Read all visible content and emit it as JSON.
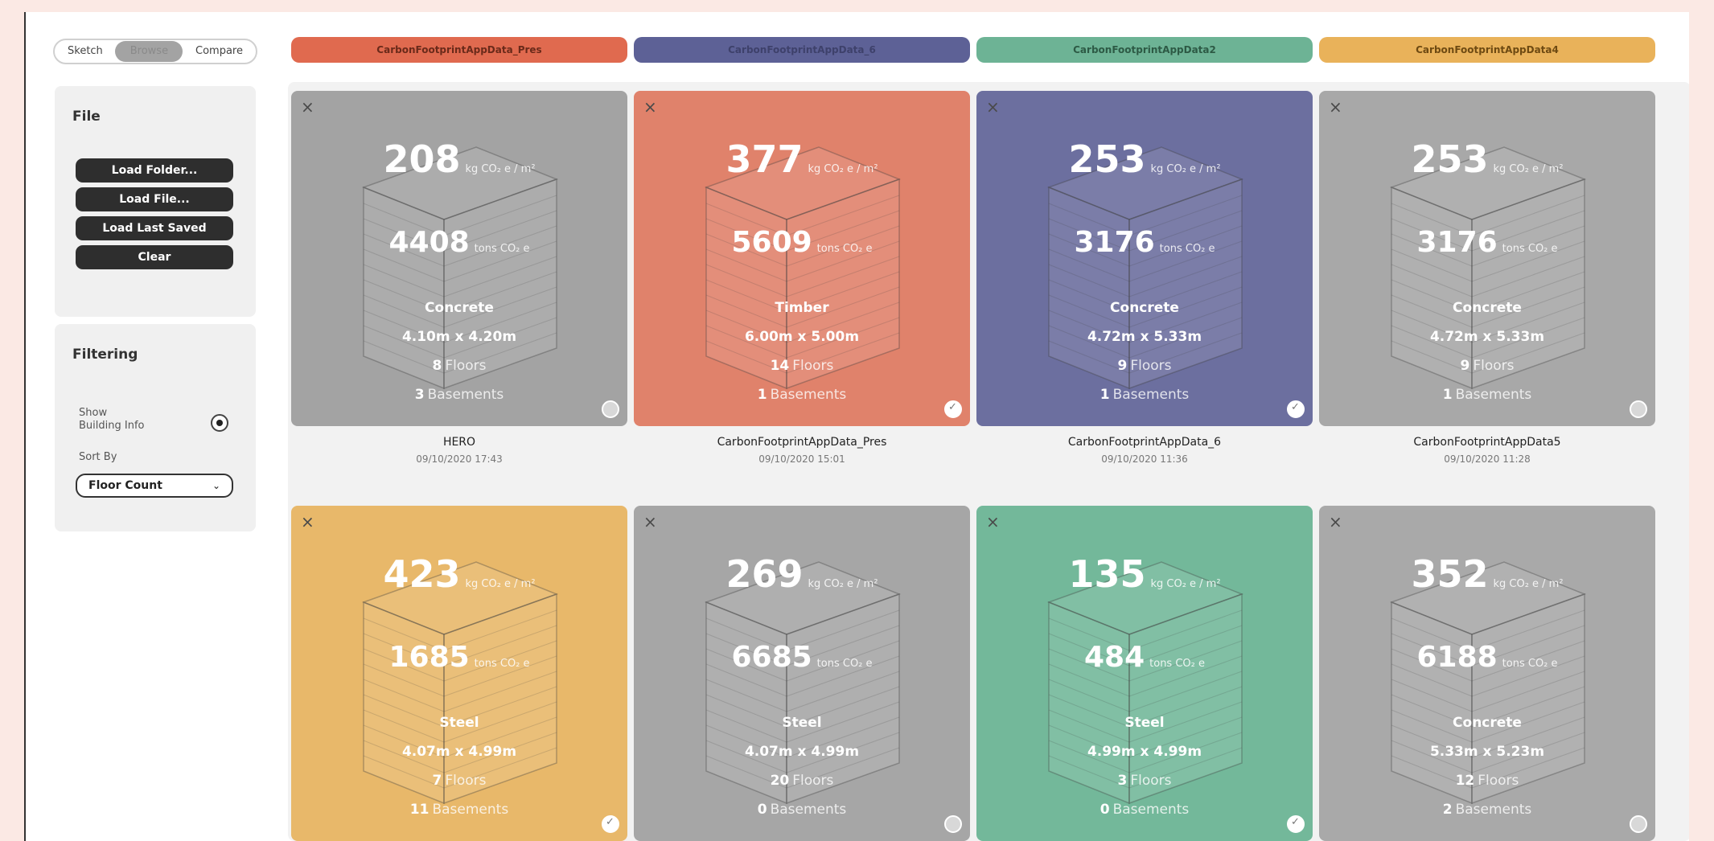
{
  "mode_toggle": {
    "options": [
      "Sketch",
      "Browse",
      "Compare"
    ],
    "active": "Browse"
  },
  "sidebar": {
    "file": {
      "title": "File",
      "buttons": [
        "Load Folder...",
        "Load File...",
        "Load Last Saved",
        "Clear"
      ]
    },
    "filtering": {
      "title": "Filtering",
      "show_building_info_label": "Show\nBuilding Info",
      "show_building_info": true,
      "sort_label": "Sort By",
      "sort_value": "Floor Count",
      "sort_chevron": "⌄"
    }
  },
  "header_pills": [
    {
      "label": "CarbonFootprintAppData_Pres",
      "color": "#e06a4f"
    },
    {
      "label": "CarbonFootprintAppData_6",
      "color": "#5d6196"
    },
    {
      "label": "CarbonFootprintAppData2",
      "color": "#6db395"
    },
    {
      "label": "CarbonFootprintAppData4",
      "color": "#e9b25a"
    }
  ],
  "cards": [
    {
      "color": "#a3a3a3",
      "intensity": "208",
      "intensity_unit": "kg CO₂ e / m²",
      "total": "4408",
      "total_unit": "tons CO₂ e",
      "material": "Concrete",
      "dimensions": "4.10m x 4.20m",
      "floors": "8",
      "floors_label": "Floors",
      "basements": "3",
      "basements_label": "Basements",
      "name": "HERO",
      "date": "09/10/2020 17:43",
      "checked": false
    },
    {
      "color": "#e0826b",
      "intensity": "377",
      "intensity_unit": "kg CO₂ e / m²",
      "total": "5609",
      "total_unit": "tons CO₂ e",
      "material": "Timber",
      "dimensions": "6.00m x 5.00m",
      "floors": "14",
      "floors_label": "Floors",
      "basements": "1",
      "basements_label": "Basements",
      "name": "CarbonFootprintAppData_Pres",
      "date": "09/10/2020 15:01",
      "checked": true
    },
    {
      "color": "#6c6f9f",
      "intensity": "253",
      "intensity_unit": "kg CO₂ e / m²",
      "total": "3176",
      "total_unit": "tons CO₂ e",
      "material": "Concrete",
      "dimensions": "4.72m x 5.33m",
      "floors": "9",
      "floors_label": "Floors",
      "basements": "1",
      "basements_label": "Basements",
      "name": "CarbonFootprintAppData_6",
      "date": "09/10/2020 11:36",
      "checked": true
    },
    {
      "color": "#a8a8a8",
      "intensity": "253",
      "intensity_unit": "kg CO₂ e / m²",
      "total": "3176",
      "total_unit": "tons CO₂ e",
      "material": "Concrete",
      "dimensions": "4.72m x 5.33m",
      "floors": "9",
      "floors_label": "Floors",
      "basements": "1",
      "basements_label": "Basements",
      "name": "CarbonFootprintAppData5",
      "date": "09/10/2020 11:28",
      "checked": false
    },
    {
      "color": "#e8b86a",
      "intensity": "423",
      "intensity_unit": "kg CO₂ e / m²",
      "total": "1685",
      "total_unit": "tons CO₂ e",
      "material": "Steel",
      "dimensions": "4.07m x 4.99m",
      "floors": "7",
      "floors_label": "Floors",
      "basements": "11",
      "basements_label": "Basements",
      "name": "",
      "date": "",
      "checked": true
    },
    {
      "color": "#a6a6a6",
      "intensity": "269",
      "intensity_unit": "kg CO₂ e / m²",
      "total": "6685",
      "total_unit": "tons CO₂ e",
      "material": "Steel",
      "dimensions": "4.07m x 4.99m",
      "floors": "20",
      "floors_label": "Floors",
      "basements": "0",
      "basements_label": "Basements",
      "name": "",
      "date": "",
      "checked": false
    },
    {
      "color": "#73b89a",
      "intensity": "135",
      "intensity_unit": "kg CO₂ e / m²",
      "total": "484",
      "total_unit": "tons CO₂ e",
      "material": "Steel",
      "dimensions": "4.99m x 4.99m",
      "floors": "3",
      "floors_label": "Floors",
      "basements": "0",
      "basements_label": "Basements",
      "name": "",
      "date": "",
      "checked": true
    },
    {
      "color": "#a9a9a9",
      "intensity": "352",
      "intensity_unit": "kg CO₂ e / m²",
      "total": "6188",
      "total_unit": "tons CO₂ e",
      "material": "Concrete",
      "dimensions": "5.33m x 5.23m",
      "floors": "12",
      "floors_label": "Floors",
      "basements": "2",
      "basements_label": "Basements",
      "name": "",
      "date": "",
      "checked": false
    }
  ],
  "icons": {
    "close": "×",
    "check": "check-circle-icon"
  }
}
